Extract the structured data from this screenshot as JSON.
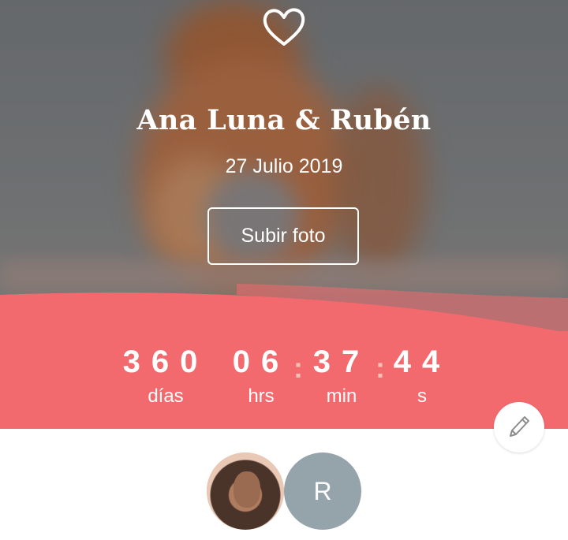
{
  "hero": {
    "icon": "heart-icon",
    "title": "Ana Luna & Rubén",
    "date": "27 Julio 2019",
    "upload_label": "Subir foto"
  },
  "countdown": {
    "days": {
      "value": "360",
      "label": "días"
    },
    "hours": {
      "value": "06",
      "label": "hrs"
    },
    "minutes": {
      "value": "37",
      "label": "min"
    },
    "seconds": {
      "value": "44",
      "label": "s"
    },
    "separator": ":"
  },
  "edit": {
    "icon": "pencil-icon"
  },
  "avatars": [
    {
      "type": "photo"
    },
    {
      "type": "initial",
      "initial": "R"
    }
  ],
  "colors": {
    "accent": "#f26a6e",
    "avatar_initial_bg": "#95a3ab"
  }
}
